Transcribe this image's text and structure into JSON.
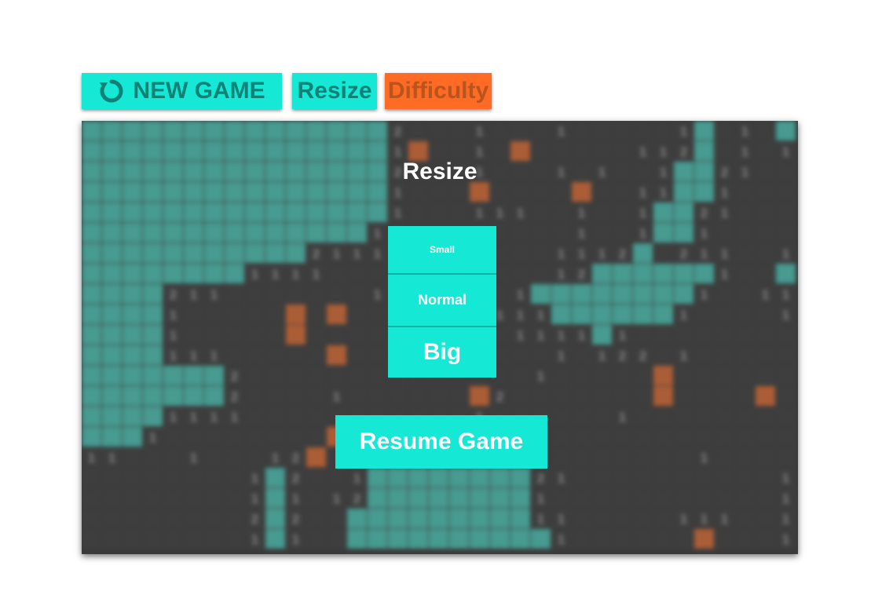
{
  "toolbar": {
    "new_game_label": "NEW GAME",
    "new_game_icon": "refresh-icon",
    "resize_label": "Resize",
    "difficulty_label": "Difficulty"
  },
  "dialog": {
    "title": "Resize",
    "options": {
      "small": "Small",
      "normal": "Normal",
      "big": "Big"
    },
    "resume_label": "Resume Game"
  },
  "colors": {
    "accent": "#16e8d6",
    "accent_text": "#0f8176",
    "difficulty": "#ff6a24",
    "revealed_tile": "#4fb5a8",
    "hidden_tile": "#444444",
    "flag_tile": "#c96a3a",
    "number_text": "#9a9a9a"
  },
  "board": {
    "cols": 35,
    "rows": 21,
    "map": [
      "AAAAAAAAAAAAAAA2...1...1.....1A.1.AAAA",
      "AAAAAAAAAAAAAAA1F..1.F.....112A.1.11AA",
      "AAAAAAAAAAAAAAA2...1...1.1..1AA21..1AA",
      "AAAAAAAAAAAAAAA1...F....F..11AA1....1A",
      "AAAAAAAAAAAAAAA1...111..1..1AA21...11A",
      "AAAAAAAAAAAAAA11........1..1AA1.....1A",
      "AAAAAAAAAAA2111........1112A.211..112A",
      "AAAAAAAA1111.......1...12AAAAAA1..AAAA",
      "AAAA211.......1......1AAAAAAAA1..1121A",
      "AAAA1.....F.F..1....111AAAAAA1....1111",
      "AAAA1.....F..........1111A1.........1A",
      "AAAA111.....F..........1.122.1......1A",
      "AAAAAAA2..............1.....F.......1A",
      "AAAAAAA2....1......F2.......F....F..1A",
      "AAAA1111...........1......1.........1A",
      "AAA1........F.1....................1AA",
      "11...1...12F...1..............1.....1A",
      "........1A2..1AAAAAAAA21..........1.11",
      "........1A1.12AAAAAAAA1...........111",
      "........2A2..AAAAAAAAA11.....111..12AA",
      "........1A1..AAAAAAAAAA1......F...1AAA"
    ]
  }
}
